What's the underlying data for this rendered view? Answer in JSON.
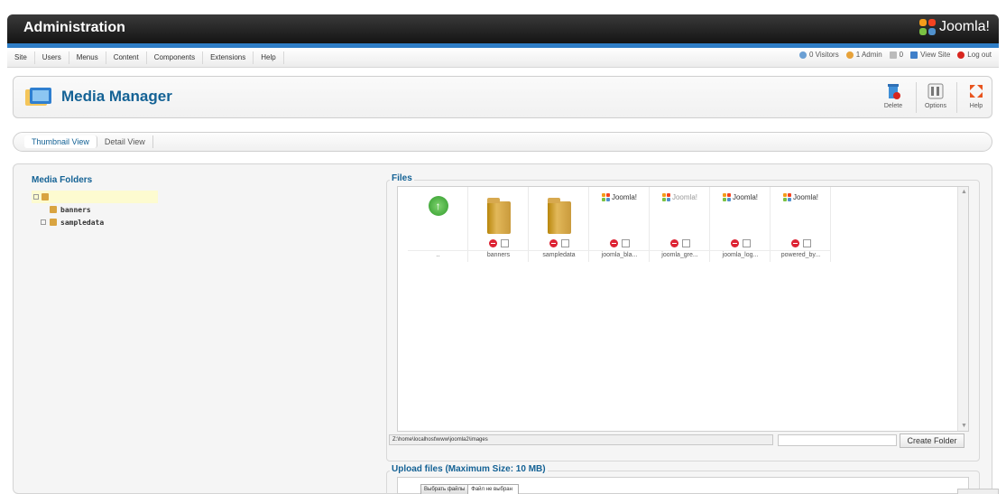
{
  "header": {
    "title": "Administration",
    "brand": "Joomla!"
  },
  "menu": {
    "items": [
      "Site",
      "Users",
      "Menus",
      "Content",
      "Components",
      "Extensions",
      "Help"
    ]
  },
  "status": {
    "visitors": "0 Visitors",
    "admins": "1 Admin",
    "messages": "0",
    "view_site": "View Site",
    "logout": "Log out"
  },
  "toolbar": {
    "title": "Media Manager",
    "delete_label": "Delete",
    "options_label": "Options",
    "help_label": "Help"
  },
  "view_tabs": {
    "thumbnail": "Thumbnail View",
    "detail": "Detail View"
  },
  "folders": {
    "title": "Media Folders",
    "items": [
      "banners",
      "sampledata"
    ]
  },
  "files": {
    "legend": "Files",
    "up_label": "..",
    "items": [
      {
        "name": "banners",
        "type": "folder"
      },
      {
        "name": "sampledata",
        "type": "folder"
      },
      {
        "name": "joomla_bla...",
        "type": "image",
        "logo": "Joomla!"
      },
      {
        "name": "joomla_gre...",
        "type": "image",
        "logo": "Joomla!"
      },
      {
        "name": "joomla_log...",
        "type": "image",
        "logo": "Joomla!"
      },
      {
        "name": "powered_by...",
        "type": "image",
        "logo": "Joomla!"
      }
    ],
    "path": "Z:\\home\\localhost\\www\\joomla2\\images",
    "create_folder": "Create Folder"
  },
  "upload": {
    "legend": "Upload files (Maximum Size: 10 MB)",
    "choose_button": "Выбрать файлы",
    "no_file": "Файл не выбран"
  },
  "colors": {
    "accent_blue": "#146295",
    "header_strip": "#2e7dc6",
    "delete_red": "#dd2233"
  }
}
